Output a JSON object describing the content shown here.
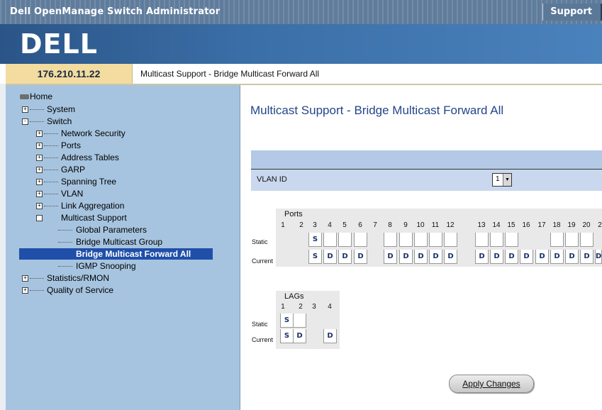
{
  "app": {
    "title": "Dell OpenManage Switch Administrator",
    "support": "Support",
    "logo": "DELL"
  },
  "device": {
    "ip": "176.210.11.22"
  },
  "breadcrumb": "Multicast Support - Bridge Multicast Forward All",
  "sidebar": {
    "home": "Home",
    "items": [
      {
        "label": "System",
        "expander": "+"
      },
      {
        "label": "Switch",
        "expander": "-"
      },
      {
        "label": "Network Security",
        "expander": "+"
      },
      {
        "label": "Ports",
        "expander": "+"
      },
      {
        "label": "Address Tables",
        "expander": "+"
      },
      {
        "label": "GARP",
        "expander": "+"
      },
      {
        "label": "Spanning Tree",
        "expander": "+"
      },
      {
        "label": "VLAN",
        "expander": "+"
      },
      {
        "label": "Link Aggregation",
        "expander": "+"
      },
      {
        "label": "Multicast Support",
        "expander": ""
      },
      {
        "label": "Global Parameters"
      },
      {
        "label": "Bridge Multicast Group"
      },
      {
        "label": "Bridge Multicast Forward All",
        "selected": true
      },
      {
        "label": "IGMP Snooping"
      },
      {
        "label": "Statistics/RMON",
        "expander": "+"
      },
      {
        "label": "Quality of Service",
        "expander": "+"
      }
    ]
  },
  "main": {
    "title": "Multicast Support - Bridge Multicast Forward All",
    "vlan_label": "VLAN ID",
    "vlan_value": "1",
    "ports": {
      "title": "Ports",
      "row_labels": [
        "Static",
        "Current"
      ],
      "numbers": [
        "1",
        "2",
        "3",
        "4",
        "5",
        "6",
        "7",
        "8",
        "9",
        "10",
        "11",
        "12",
        "13",
        "14",
        "15",
        "16",
        "17",
        "18",
        "19",
        "20",
        "2"
      ],
      "static": [
        "S",
        "",
        "",
        "",
        "",
        "",
        "",
        "",
        "",
        "",
        "",
        "",
        "",
        "",
        ""
      ],
      "current": [
        "S",
        "D",
        "D",
        "D",
        "D",
        "D",
        "D",
        "D",
        "D",
        "D",
        "D",
        "D",
        "D",
        "D",
        "D",
        "D",
        "D",
        "D",
        "D"
      ]
    },
    "lags": {
      "title": "LAGs",
      "row_labels": [
        "Static",
        "Current"
      ],
      "numbers": [
        "1",
        "2",
        "3",
        "4"
      ],
      "static": [
        "S",
        ""
      ],
      "current": [
        "S",
        "D",
        "D"
      ]
    },
    "apply_label": "Apply Changes"
  }
}
